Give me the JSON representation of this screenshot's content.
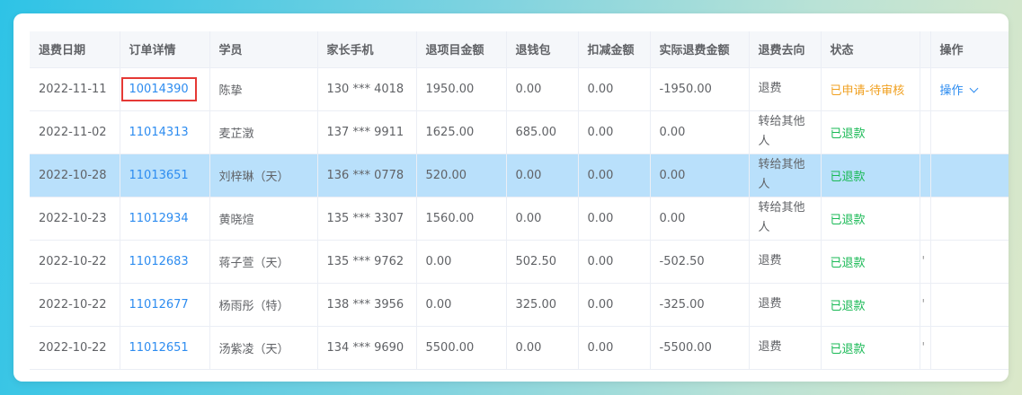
{
  "headers": [
    "退费日期",
    "订单详情",
    "学员",
    "家长手机",
    "退项目金额",
    "退钱包",
    "扣减金额",
    "实际退费金额",
    "退费去向",
    "状态",
    "",
    "操作"
  ],
  "rows": [
    {
      "date": "2022-11-11",
      "order": "10014390",
      "student": "陈挚",
      "phone": "130 *** 4018",
      "item_amt": "1950.00",
      "wallet": "0.00",
      "deduct": "0.00",
      "actual": "-1950.00",
      "dest": "退费",
      "status": "已申请-待审核",
      "status_type": "pending",
      "op": "操作",
      "extra": ""
    },
    {
      "date": "2022-11-02",
      "order": "11014313",
      "student": "麦芷澂",
      "phone": "137 *** 9911",
      "item_amt": "1625.00",
      "wallet": "685.00",
      "deduct": "0.00",
      "actual": "0.00",
      "dest": "转给其他人",
      "status": "已退款",
      "status_type": "done",
      "op": "",
      "extra": ""
    },
    {
      "date": "2022-10-28",
      "order": "11013651",
      "student": "刘梓琳（天）",
      "phone": "136 *** 0778",
      "item_amt": "520.00",
      "wallet": "0.00",
      "deduct": "0.00",
      "actual": "0.00",
      "dest": "转给其他人",
      "status": "已退款",
      "status_type": "done",
      "op": "",
      "extra": ""
    },
    {
      "date": "2022-10-23",
      "order": "11012934",
      "student": "黄晓煊",
      "phone": "135 *** 3307",
      "item_amt": "1560.00",
      "wallet": "0.00",
      "deduct": "0.00",
      "actual": "0.00",
      "dest": "转给其他人",
      "status": "已退款",
      "status_type": "done",
      "op": "",
      "extra": ""
    },
    {
      "date": "2022-10-22",
      "order": "11012683",
      "student": "蒋子萱（天）",
      "phone": "135 *** 9762",
      "item_amt": "0.00",
      "wallet": "502.50",
      "deduct": "0.00",
      "actual": "-502.50",
      "dest": "退费",
      "status": "已退款",
      "status_type": "done",
      "op": "",
      "extra": "'"
    },
    {
      "date": "2022-10-22",
      "order": "11012677",
      "student": "杨雨彤（特）",
      "phone": "138 *** 3956",
      "item_amt": "0.00",
      "wallet": "325.00",
      "deduct": "0.00",
      "actual": "-325.00",
      "dest": "退费",
      "status": "已退款",
      "status_type": "done",
      "op": "",
      "extra": "'"
    },
    {
      "date": "2022-10-22",
      "order": "11012651",
      "student": "汤紫凌（天）",
      "phone": "134 *** 9690",
      "item_amt": "5500.00",
      "wallet": "0.00",
      "deduct": "0.00",
      "actual": "-5500.00",
      "dest": "退费",
      "status": "已退款",
      "status_type": "done",
      "op": "",
      "extra": "'"
    }
  ],
  "colors": {
    "link": "#2d8cf0",
    "pending": "#f0a020",
    "done": "#19b955",
    "selected_row": "#b9e0fb",
    "highlight_box": "#e53935"
  }
}
